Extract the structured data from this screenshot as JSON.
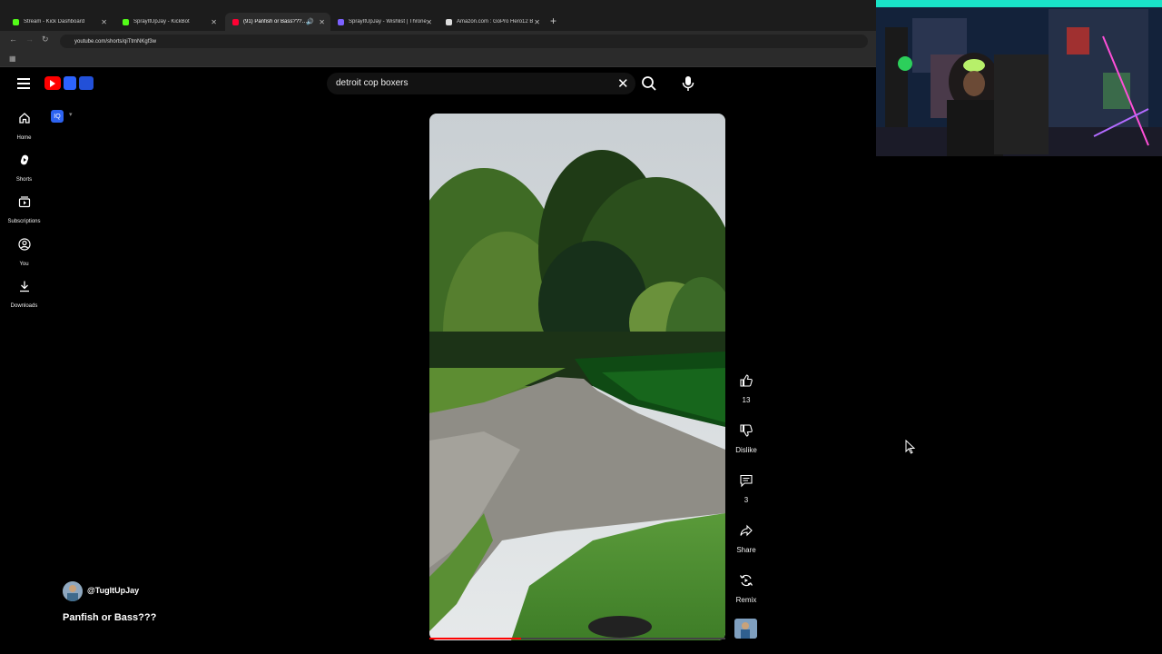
{
  "browser": {
    "tabs": [
      {
        "label": "Stream - Kick Dashboard",
        "color": "#53fc18"
      },
      {
        "label": "SprayItUpJay - KickBot",
        "color": "#53fc18"
      },
      {
        "label": "(91) Panfish or Bass??? - Yo",
        "color": "#ff0033"
      },
      {
        "label": "SprayItUpJay - Wishlist | Throne",
        "color": "#7b61ff"
      },
      {
        "label": "Amazon.com : GoPro Hero12 B",
        "color": "#dddddd"
      }
    ],
    "url": "youtube.com/shorts/qiTtmNKgf3w"
  },
  "search": {
    "query": "detroit cop boxers"
  },
  "sidebar": {
    "items": [
      {
        "label": "Home",
        "icon": "home-icon"
      },
      {
        "label": "Shorts",
        "icon": "shorts-icon"
      },
      {
        "label": "Subscriptions",
        "icon": "subscriptions-icon"
      },
      {
        "label": "You",
        "icon": "you-icon"
      },
      {
        "label": "Downloads",
        "icon": "download-icon"
      }
    ]
  },
  "short": {
    "channel": "@TugItUpJay",
    "title": "Panfish or Bass???",
    "progress": 0.31
  },
  "actions": {
    "like_count": "13",
    "dislike_label": "Dislike",
    "comment_count": "3",
    "share_label": "Share",
    "remix_label": "Remix"
  },
  "colors": {
    "brand": "#ff0000",
    "background": "#000000"
  }
}
